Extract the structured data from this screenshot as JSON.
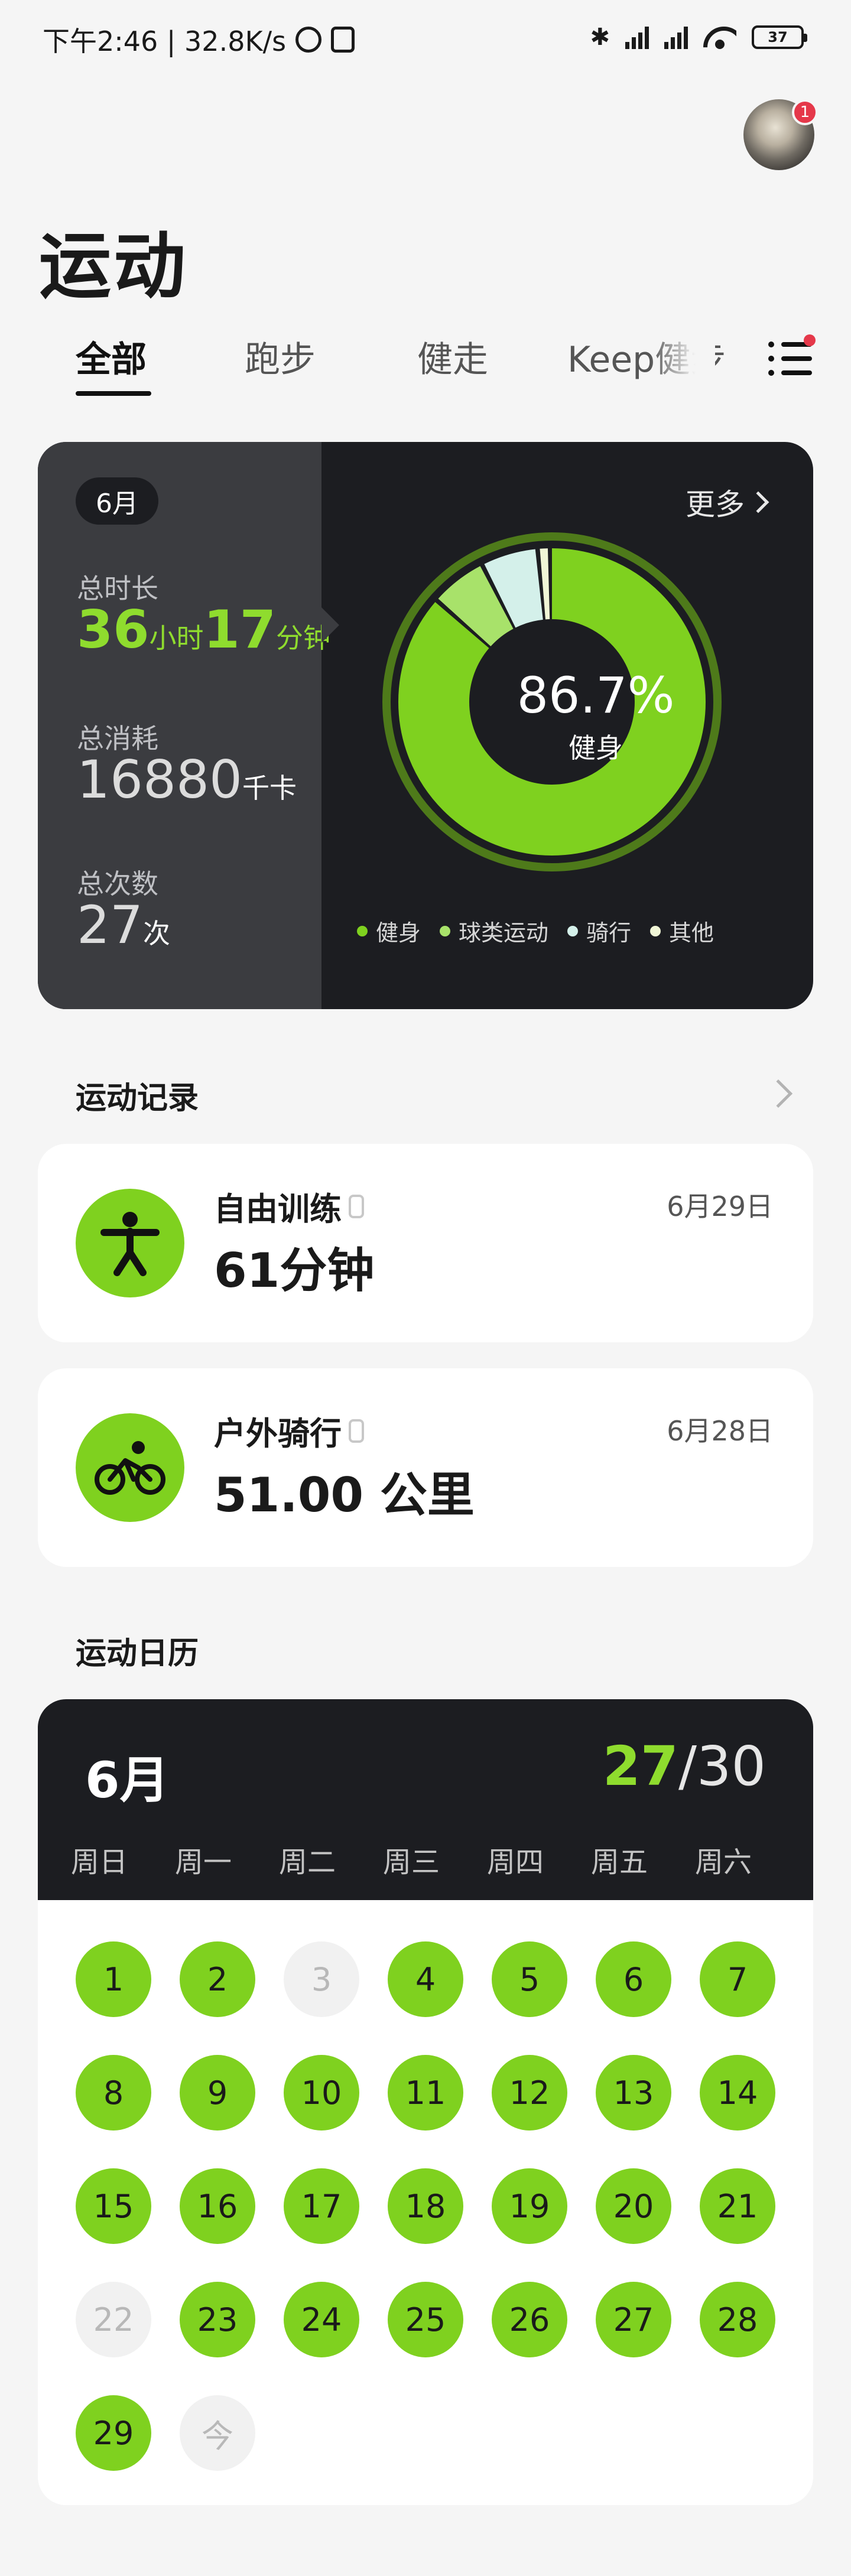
{
  "status_bar": {
    "time_speed": "下午2:46 | 32.8K/s",
    "battery": "37"
  },
  "header": {
    "title": "运动",
    "avatar_badge": "1"
  },
  "tabs": [
    "全部",
    "跑步",
    "健走",
    "Keep健步"
  ],
  "summary": {
    "month": "6月",
    "more_label": "更多",
    "duration_label": "总时长",
    "duration_hours": "36",
    "duration_hours_unit": "小时",
    "duration_minutes": "17",
    "duration_minutes_unit": "分钟",
    "calories_label": "总消耗",
    "calories_value": "16880",
    "calories_unit": "千卡",
    "count_label": "总次数",
    "count_value": "27",
    "count_unit": "次",
    "donut_percent": "86.7%",
    "donut_caption": "健身",
    "breakdown": [
      {
        "name": "健身",
        "color": "#7fd11f",
        "fraction": 0.867
      },
      {
        "name": "球类运动",
        "color": "#a8e26a",
        "fraction": 0.06
      },
      {
        "name": "骑行",
        "color": "#d4f0ea",
        "fraction": 0.06
      },
      {
        "name": "其他",
        "color": "#f0f6d6",
        "fraction": 0.013
      }
    ]
  },
  "records_section": {
    "title": "运动记录",
    "items": [
      {
        "name": "自由训练",
        "value": "61分钟",
        "date": "6月29日",
        "icon": "person-training-icon"
      },
      {
        "name": "户外骑行",
        "value": "51.00 公里",
        "date": "6月28日",
        "icon": "cycling-icon"
      }
    ]
  },
  "calendar_section": {
    "title": "运动日历",
    "month": "6月",
    "done": "27",
    "total": "/30",
    "weekdays": [
      "周日",
      "周一",
      "周二",
      "周三",
      "周四",
      "周五",
      "周六"
    ],
    "days": [
      {
        "label": "1",
        "active": true
      },
      {
        "label": "2",
        "active": true
      },
      {
        "label": "3",
        "active": false
      },
      {
        "label": "4",
        "active": true
      },
      {
        "label": "5",
        "active": true
      },
      {
        "label": "6",
        "active": true
      },
      {
        "label": "7",
        "active": true
      },
      {
        "label": "8",
        "active": true
      },
      {
        "label": "9",
        "active": true
      },
      {
        "label": "10",
        "active": true
      },
      {
        "label": "11",
        "active": true
      },
      {
        "label": "12",
        "active": true
      },
      {
        "label": "13",
        "active": true
      },
      {
        "label": "14",
        "active": true
      },
      {
        "label": "15",
        "active": true
      },
      {
        "label": "16",
        "active": true
      },
      {
        "label": "17",
        "active": true
      },
      {
        "label": "18",
        "active": true
      },
      {
        "label": "19",
        "active": true
      },
      {
        "label": "20",
        "active": true
      },
      {
        "label": "21",
        "active": true
      },
      {
        "label": "22",
        "active": false
      },
      {
        "label": "23",
        "active": true
      },
      {
        "label": "24",
        "active": true
      },
      {
        "label": "25",
        "active": true
      },
      {
        "label": "26",
        "active": true
      },
      {
        "label": "27",
        "active": true
      },
      {
        "label": "28",
        "active": true
      },
      {
        "label": "29",
        "active": true
      },
      {
        "label": "今",
        "active": false
      }
    ]
  }
}
